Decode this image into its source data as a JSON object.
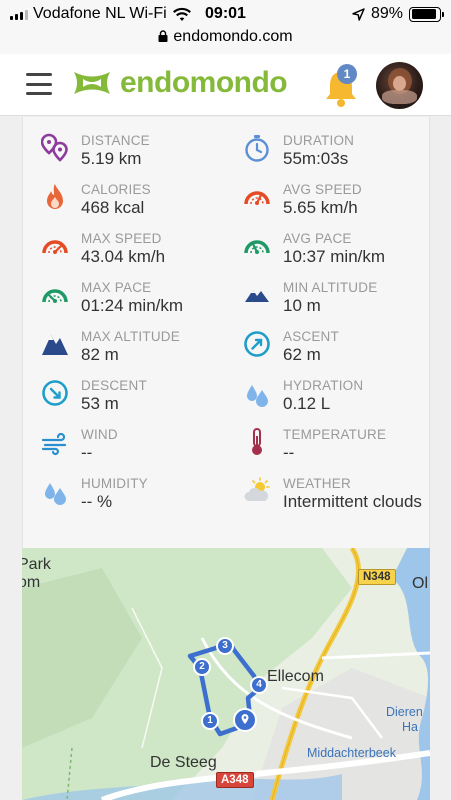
{
  "status_bar": {
    "carrier": "Vodafone NL Wi-Fi",
    "time": "09:01",
    "battery": "89%",
    "battery_level": 0.89
  },
  "browser": {
    "url": "endomondo.com"
  },
  "header": {
    "logo_text": "endomondo",
    "notification_count": "1",
    "brand_color": "#84b93a"
  },
  "stats": [
    {
      "icon": "distance-pins-icon",
      "label": "DISTANCE",
      "value": "5.19 km"
    },
    {
      "icon": "stopwatch-icon",
      "label": "DURATION",
      "value": "55m:03s"
    },
    {
      "icon": "flame-icon",
      "label": "CALORIES",
      "value": "468 kcal"
    },
    {
      "icon": "speedometer-icon",
      "label": "AVG SPEED",
      "value": "5.65 km/h"
    },
    {
      "icon": "speedometer-icon",
      "label": "MAX SPEED",
      "value": "43.04 km/h"
    },
    {
      "icon": "pace-gauge-icon",
      "label": "AVG PACE",
      "value": "10:37 min/km"
    },
    {
      "icon": "pace-gauge-icon",
      "label": "MAX PACE",
      "value": "01:24 min/km"
    },
    {
      "icon": "mountain-low-icon",
      "label": "MIN ALTITUDE",
      "value": "10 m"
    },
    {
      "icon": "mountain-high-icon",
      "label": "MAX ALTITUDE",
      "value": "82 m"
    },
    {
      "icon": "ascent-arrow-icon",
      "label": "ASCENT",
      "value": "62 m"
    },
    {
      "icon": "descent-arrow-icon",
      "label": "DESCENT",
      "value": "53 m"
    },
    {
      "icon": "water-drops-icon",
      "label": "HYDRATION",
      "value": "0.12 L"
    },
    {
      "icon": "wind-icon",
      "label": "WIND",
      "value": "--"
    },
    {
      "icon": "thermometer-icon",
      "label": "TEMPERATURE",
      "value": "--"
    },
    {
      "icon": "water-drops-icon",
      "label": "HUMIDITY",
      "value": "-- %"
    },
    {
      "icon": "partly-cloudy-icon",
      "label": "WEATHER",
      "value": "Intermittent clouds"
    }
  ],
  "map": {
    "labels": [
      "Park",
      "om",
      "Ellecom",
      "De Steeg",
      "Middachterbeek",
      "Dieren",
      "Ha",
      "Ol"
    ],
    "roads": [
      "N348",
      "A348"
    ],
    "markers": [
      "1",
      "2",
      "3",
      "4"
    ]
  }
}
